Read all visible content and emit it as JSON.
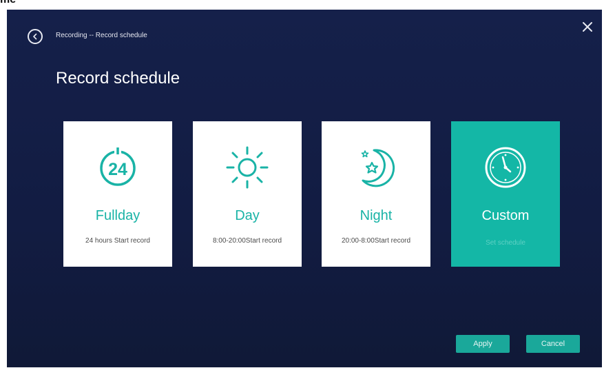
{
  "page_fragment": "me",
  "header": {
    "breadcrumb": "Recording -- Record schedule",
    "back_icon": "chevron-left-icon",
    "close_icon": "close-icon"
  },
  "title": "Record schedule",
  "cards": [
    {
      "label": "Fullday",
      "desc": "24 hours Start record",
      "icon": "24-hours-icon",
      "selected": false
    },
    {
      "label": "Day",
      "desc": "8:00-20:00Start record",
      "icon": "sun-icon",
      "selected": false
    },
    {
      "label": "Night",
      "desc": "20:00-8:00Start record",
      "icon": "moon-icon",
      "selected": false
    },
    {
      "label": "Custom",
      "desc": "Set schedule",
      "icon": "clock-icon",
      "selected": true
    }
  ],
  "icon_text": {
    "fullday": "24"
  },
  "footer": {
    "apply_label": "Apply",
    "cancel_label": "Cancel"
  },
  "colors": {
    "background": "#121c42",
    "accent": "#14b7a6",
    "card": "#ffffff",
    "button": "#1aa89a"
  }
}
